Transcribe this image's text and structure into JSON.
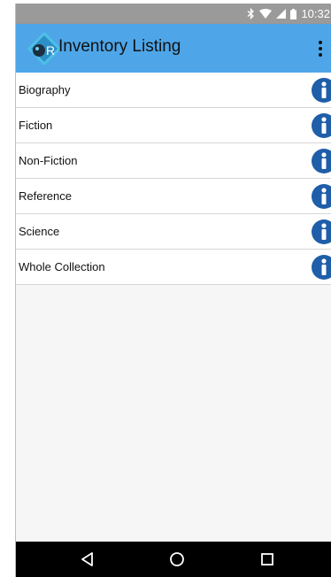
{
  "status_bar": {
    "time": "10:32",
    "icons": [
      "bluetooth-icon",
      "wifi-icon",
      "signal-icon",
      "battery-icon"
    ]
  },
  "app_bar": {
    "title": "Inventory Listing",
    "logo_icon": "app-logo-icon",
    "menu_icon": "overflow-menu-icon"
  },
  "list": {
    "items": [
      {
        "label": "Biography"
      },
      {
        "label": "Fiction"
      },
      {
        "label": "Non-Fiction"
      },
      {
        "label": "Reference"
      },
      {
        "label": "Science"
      },
      {
        "label": "Whole Collection"
      }
    ]
  },
  "nav_bar": {
    "buttons": [
      "back-icon",
      "home-icon",
      "recents-icon"
    ]
  },
  "colors": {
    "app_bar": "#4ea6e8",
    "info_icon": "#1f5ea8",
    "status_bar": "#9a9a9a",
    "nav_bar": "#000000"
  }
}
